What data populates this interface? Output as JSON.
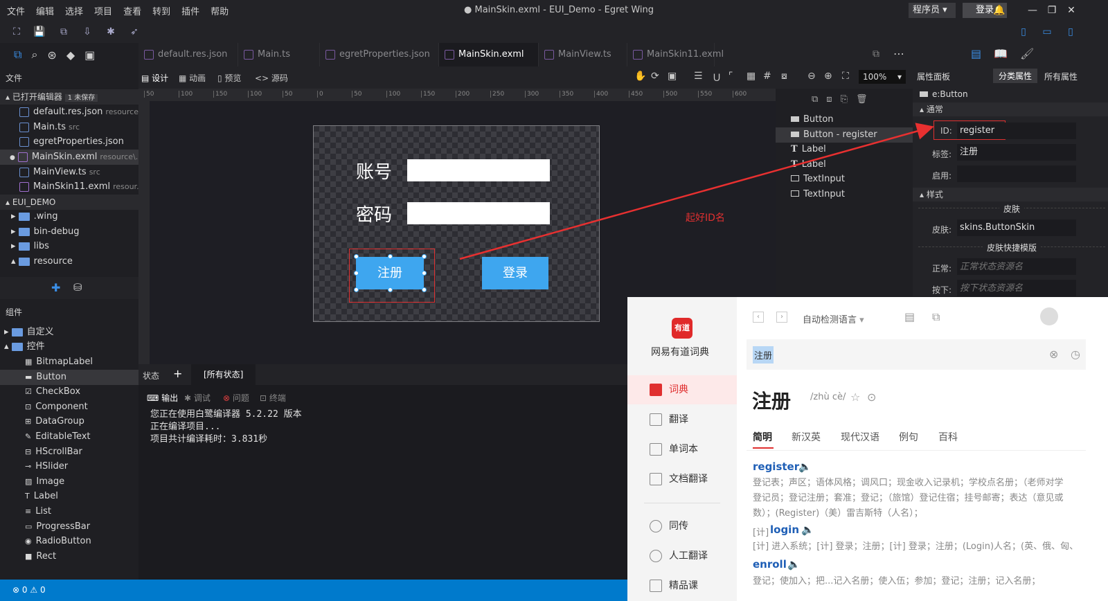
{
  "menubar": {
    "items": [
      "文件",
      "编辑",
      "选择",
      "项目",
      "查看",
      "转到",
      "插件",
      "帮助"
    ],
    "title": "● MainSkin.exml - EUI_Demo - Egret Wing",
    "role": "程序员",
    "login": "登录"
  },
  "tabs": [
    "default.res.json",
    "Main.ts",
    "egretProperties.json",
    "MainSkin.exml",
    "MainView.ts",
    "MainSkin11.exml"
  ],
  "left": {
    "files_header": "文件",
    "open_editors": "已打开编辑器",
    "unsaved_badge": "1 未保存",
    "open_files": [
      {
        "name": "default.res.json",
        "path": "resource"
      },
      {
        "name": "Main.ts",
        "path": "src"
      },
      {
        "name": "egretProperties.json",
        "path": ""
      },
      {
        "name": "MainSkin.exml",
        "path": "resource\\..."
      },
      {
        "name": "MainView.ts",
        "path": "src"
      },
      {
        "name": "MainSkin11.exml",
        "path": "resour..."
      }
    ],
    "project": "EUI_DEMO",
    "folders": [
      ".wing",
      "bin-debug",
      "libs",
      "resource"
    ],
    "components_header": "组件",
    "comp_groups": [
      "自定义",
      "控件"
    ],
    "controls": [
      "BitmapLabel",
      "Button",
      "CheckBox",
      "Component",
      "DataGroup",
      "EditableText",
      "HScrollBar",
      "HSlider",
      "Image",
      "Label",
      "List",
      "ProgressBar",
      "RadioButton",
      "Rect"
    ]
  },
  "designbar": {
    "design": "设计",
    "anim": "动画",
    "preview": "预览",
    "source": "<> 源码",
    "zoom": "100%"
  },
  "ruler": [
    "50",
    "100",
    "150",
    "100",
    "50",
    "0",
    "50",
    "100",
    "150",
    "200",
    "250",
    "300",
    "350",
    "400",
    "450",
    "500",
    "550",
    "600"
  ],
  "skin": {
    "account": "账号",
    "password": "密码",
    "register": "注册",
    "login": "登录"
  },
  "states": {
    "label": "状态",
    "add": "+",
    "all": "[所有状态]"
  },
  "output": {
    "tabs": [
      "输出",
      "调试",
      "问题",
      "终端"
    ],
    "lines": [
      "您正在使用白鹭编译器 5.2.22 版本",
      "正在编译项目...",
      "项目共计编译耗时：3.831秒"
    ]
  },
  "outline": [
    "Button",
    "Button - register",
    "Label",
    "Label",
    "TextInput",
    "TextInput"
  ],
  "props": {
    "header": "属性面板",
    "cat": "分类属性",
    "all": "所有属性",
    "element": "e:Button",
    "general": "通常",
    "id_label": "ID:",
    "id_value": "register",
    "tag_label": "标签:",
    "tag_value": "注册",
    "enabled_label": "启用:",
    "style": "样式",
    "skin_group": "皮肤",
    "skin_label": "皮肤:",
    "skin_value": "skins.ButtonSkin",
    "skin_quick": "皮肤快捷模版",
    "normal_label": "正常:",
    "normal_ph": "正常状态资源名",
    "down_label": "按下:",
    "down_ph": "按下状态资源名"
  },
  "annotation": "起好ID名",
  "status": {
    "errors": "0",
    "warnings": "0"
  },
  "dict": {
    "logo": "有道",
    "app": "网易有道词典",
    "lang": "自动检测语言",
    "nav": [
      "词典",
      "翻译",
      "单词本",
      "文档翻译",
      "同传",
      "人工翻译",
      "精品课"
    ],
    "query": "注册",
    "headword": "注册",
    "pinyin": "/zhù cè/",
    "tabs": [
      "简明",
      "新汉英",
      "现代汉语",
      "例句",
      "百科"
    ],
    "entries": [
      {
        "word": "register",
        "defs": [
          "登记表；声区；语体风格；调风口；现金收入记录机；学校点名册；（老师对学",
          "登记员；登记注册；套准；登记；（旅馆）登记住宿；挂号邮寄；表达（意见或",
          "数）；(Register)（美）雷吉斯特（人名）；"
        ]
      },
      {
        "word": "login",
        "prefix": "[计]",
        "defs": [
          "[计] 进入系统；[计] 登录；注册；[计] 登录；注册；(Login)人名；(英、俄、匈、"
        ]
      },
      {
        "word": "enroll",
        "defs": [
          "登记；使加入；把...记入名册；使入伍；参加；登记；注册；记入名册；"
        ]
      }
    ]
  }
}
